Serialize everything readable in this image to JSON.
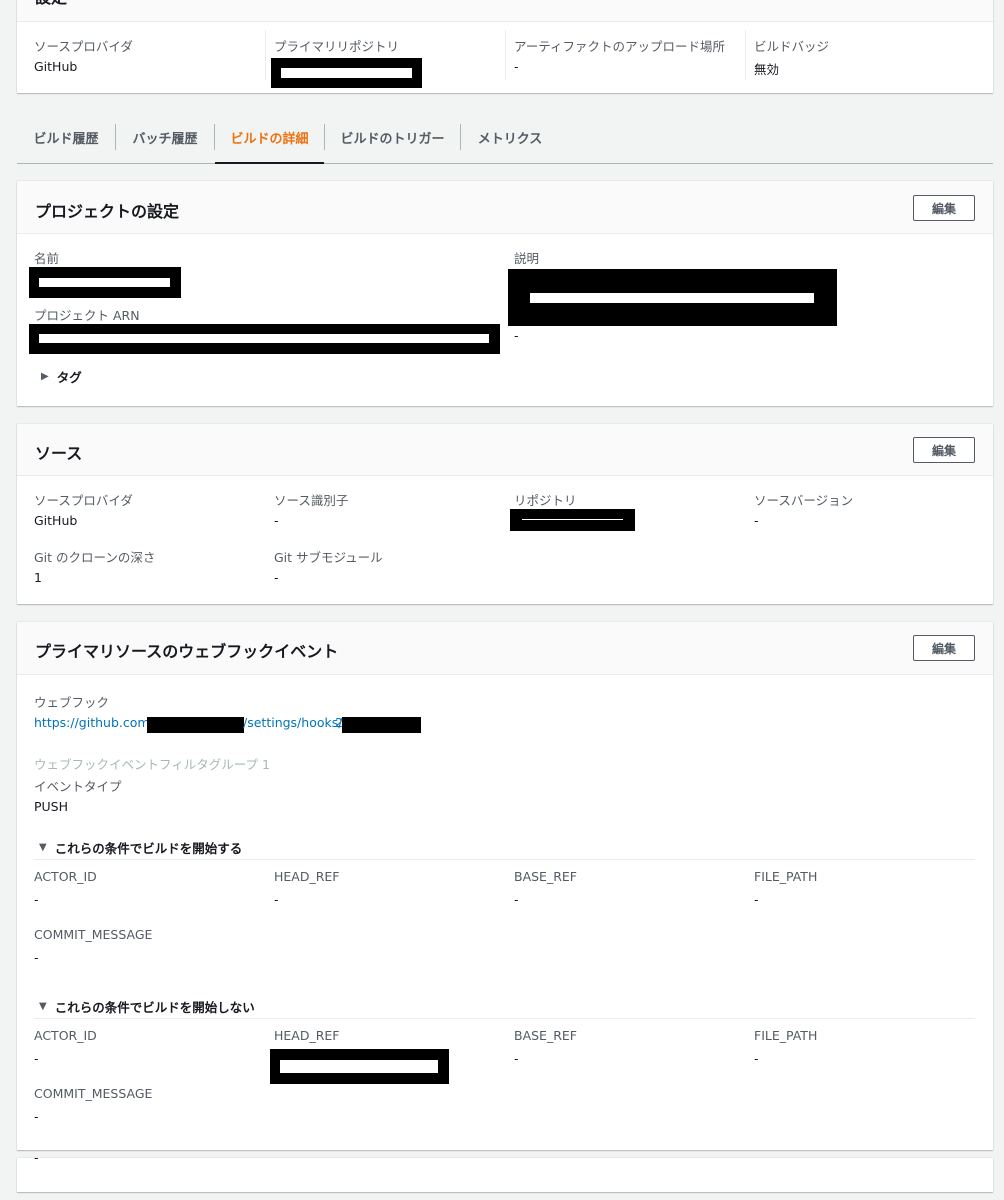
{
  "top_panel": {
    "title": "設定",
    "fields": [
      {
        "label": "ソースプロバイダ",
        "value": "GitHub"
      },
      {
        "label": "プライマリリポジトリ",
        "value": ""
      },
      {
        "label": "アーティファクトのアップロード場所",
        "value": "-"
      },
      {
        "label": "ビルドバッジ",
        "value": "無効"
      }
    ]
  },
  "tabs": [
    {
      "label": "ビルド履歴",
      "active": false
    },
    {
      "label": "バッチ履歴",
      "active": false
    },
    {
      "label": "ビルドの詳細",
      "active": true
    },
    {
      "label": "ビルドのトリガー",
      "active": false
    },
    {
      "label": "メトリクス",
      "active": false
    }
  ],
  "project_settings": {
    "title": "プロジェクトの設定",
    "edit_label": "編集",
    "name_label": "名前",
    "arn_label": "プロジェクト ARN",
    "description_label": "説明",
    "description_value": "-",
    "tags_label": "タグ"
  },
  "source": {
    "title": "ソース",
    "edit_label": "編集",
    "provider_label": "ソースプロバイダ",
    "provider_value": "GitHub",
    "identifier_label": "ソース識別子",
    "identifier_value": "-",
    "repository_label": "リポジトリ",
    "version_label": "ソースバージョン",
    "version_value": "-",
    "clone_depth_label": "Git のクローンの深さ",
    "clone_depth_value": "1",
    "submodules_label": "Git サブモジュール",
    "submodules_value": "-"
  },
  "webhook": {
    "title": "プライマリソースのウェブフックイベント",
    "edit_label": "編集",
    "webhook_label": "ウェブフック",
    "url_prefix": "https://github.com/",
    "url_middle": "/settings/hooks/",
    "url_tail_char": "2",
    "filter_group_label": "ウェブフックイベントフィルタグループ 1",
    "event_type_label": "イベントタイプ",
    "event_type_value": "PUSH",
    "start_section": {
      "title": "これらの条件でビルドを開始する",
      "fields": [
        {
          "label": "ACTOR_ID",
          "value": "-"
        },
        {
          "label": "HEAD_REF",
          "value": "-"
        },
        {
          "label": "BASE_REF",
          "value": "-"
        },
        {
          "label": "FILE_PATH",
          "value": "-"
        },
        {
          "label": "COMMIT_MESSAGE",
          "value": "-"
        }
      ]
    },
    "no_start_section": {
      "title": "これらの条件でビルドを開始しない",
      "fields": [
        {
          "label": "ACTOR_ID",
          "value": "-"
        },
        {
          "label": "HEAD_REF",
          "value": ""
        },
        {
          "label": "BASE_REF",
          "value": "-"
        },
        {
          "label": "FILE_PATH",
          "value": "-"
        },
        {
          "label": "COMMIT_MESSAGE",
          "value": "-"
        }
      ]
    }
  },
  "bottom_panel": {
    "value": "-"
  }
}
